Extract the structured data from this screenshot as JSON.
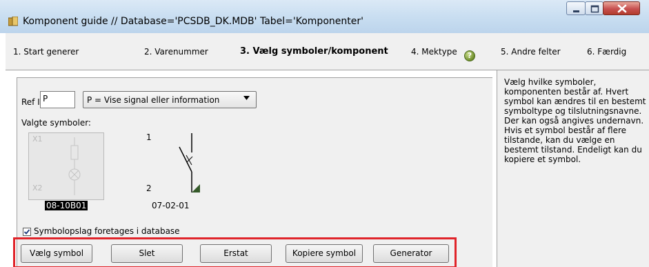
{
  "window": {
    "title": "Komponent guide // Database='PCSDB_DK.MDB' Tabel='Komponenter'"
  },
  "steps": [
    {
      "label": "1. Start generer"
    },
    {
      "label": "2. Varenummer"
    },
    {
      "label": "3. Vælg symboler/komponent"
    },
    {
      "label": "4. Mektype"
    },
    {
      "label": "5. Andre felter"
    },
    {
      "label": "6. Færdig"
    }
  ],
  "form": {
    "ref_id_label": "Ref ID:",
    "ref_id_value": "P",
    "type_select_value": "P = Vise signal eller information",
    "help_icon_glyph": "?",
    "selected_symbols_label": "Valgte symboler:",
    "checkbox_label": "Symbolopslag foretages i database"
  },
  "symbols": [
    {
      "caption": "08-10B01",
      "pin_top": "X1",
      "pin_bottom": "X2",
      "selected": true,
      "icon": "lamp-symbol-icon"
    },
    {
      "caption": "07-02-01",
      "pin_top": "1",
      "pin_bottom": "2",
      "selected": false,
      "icon": "switch-symbol-icon"
    }
  ],
  "buttons": {
    "choose_symbol": "Vælg symbol",
    "delete": "Slet",
    "replace": "Erstat",
    "copy_symbol": "Kopiere symbol",
    "generator": "Generator"
  },
  "help_text": "Vælg hvilke symboler, komponenten består af. Hvert symbol kan ændres til en bestemt symboltype og tilslutningsnavne. Der kan også angives undernavn. Hvis et symbol består af flere tilstande, kan du vælge en bestemt tilstand. Endeligt kan du kopiere et symbol.",
  "colors": {
    "title_bar": "#c9def1",
    "highlight_border": "#e0242a",
    "panel_bg": "#f0f0f0"
  }
}
